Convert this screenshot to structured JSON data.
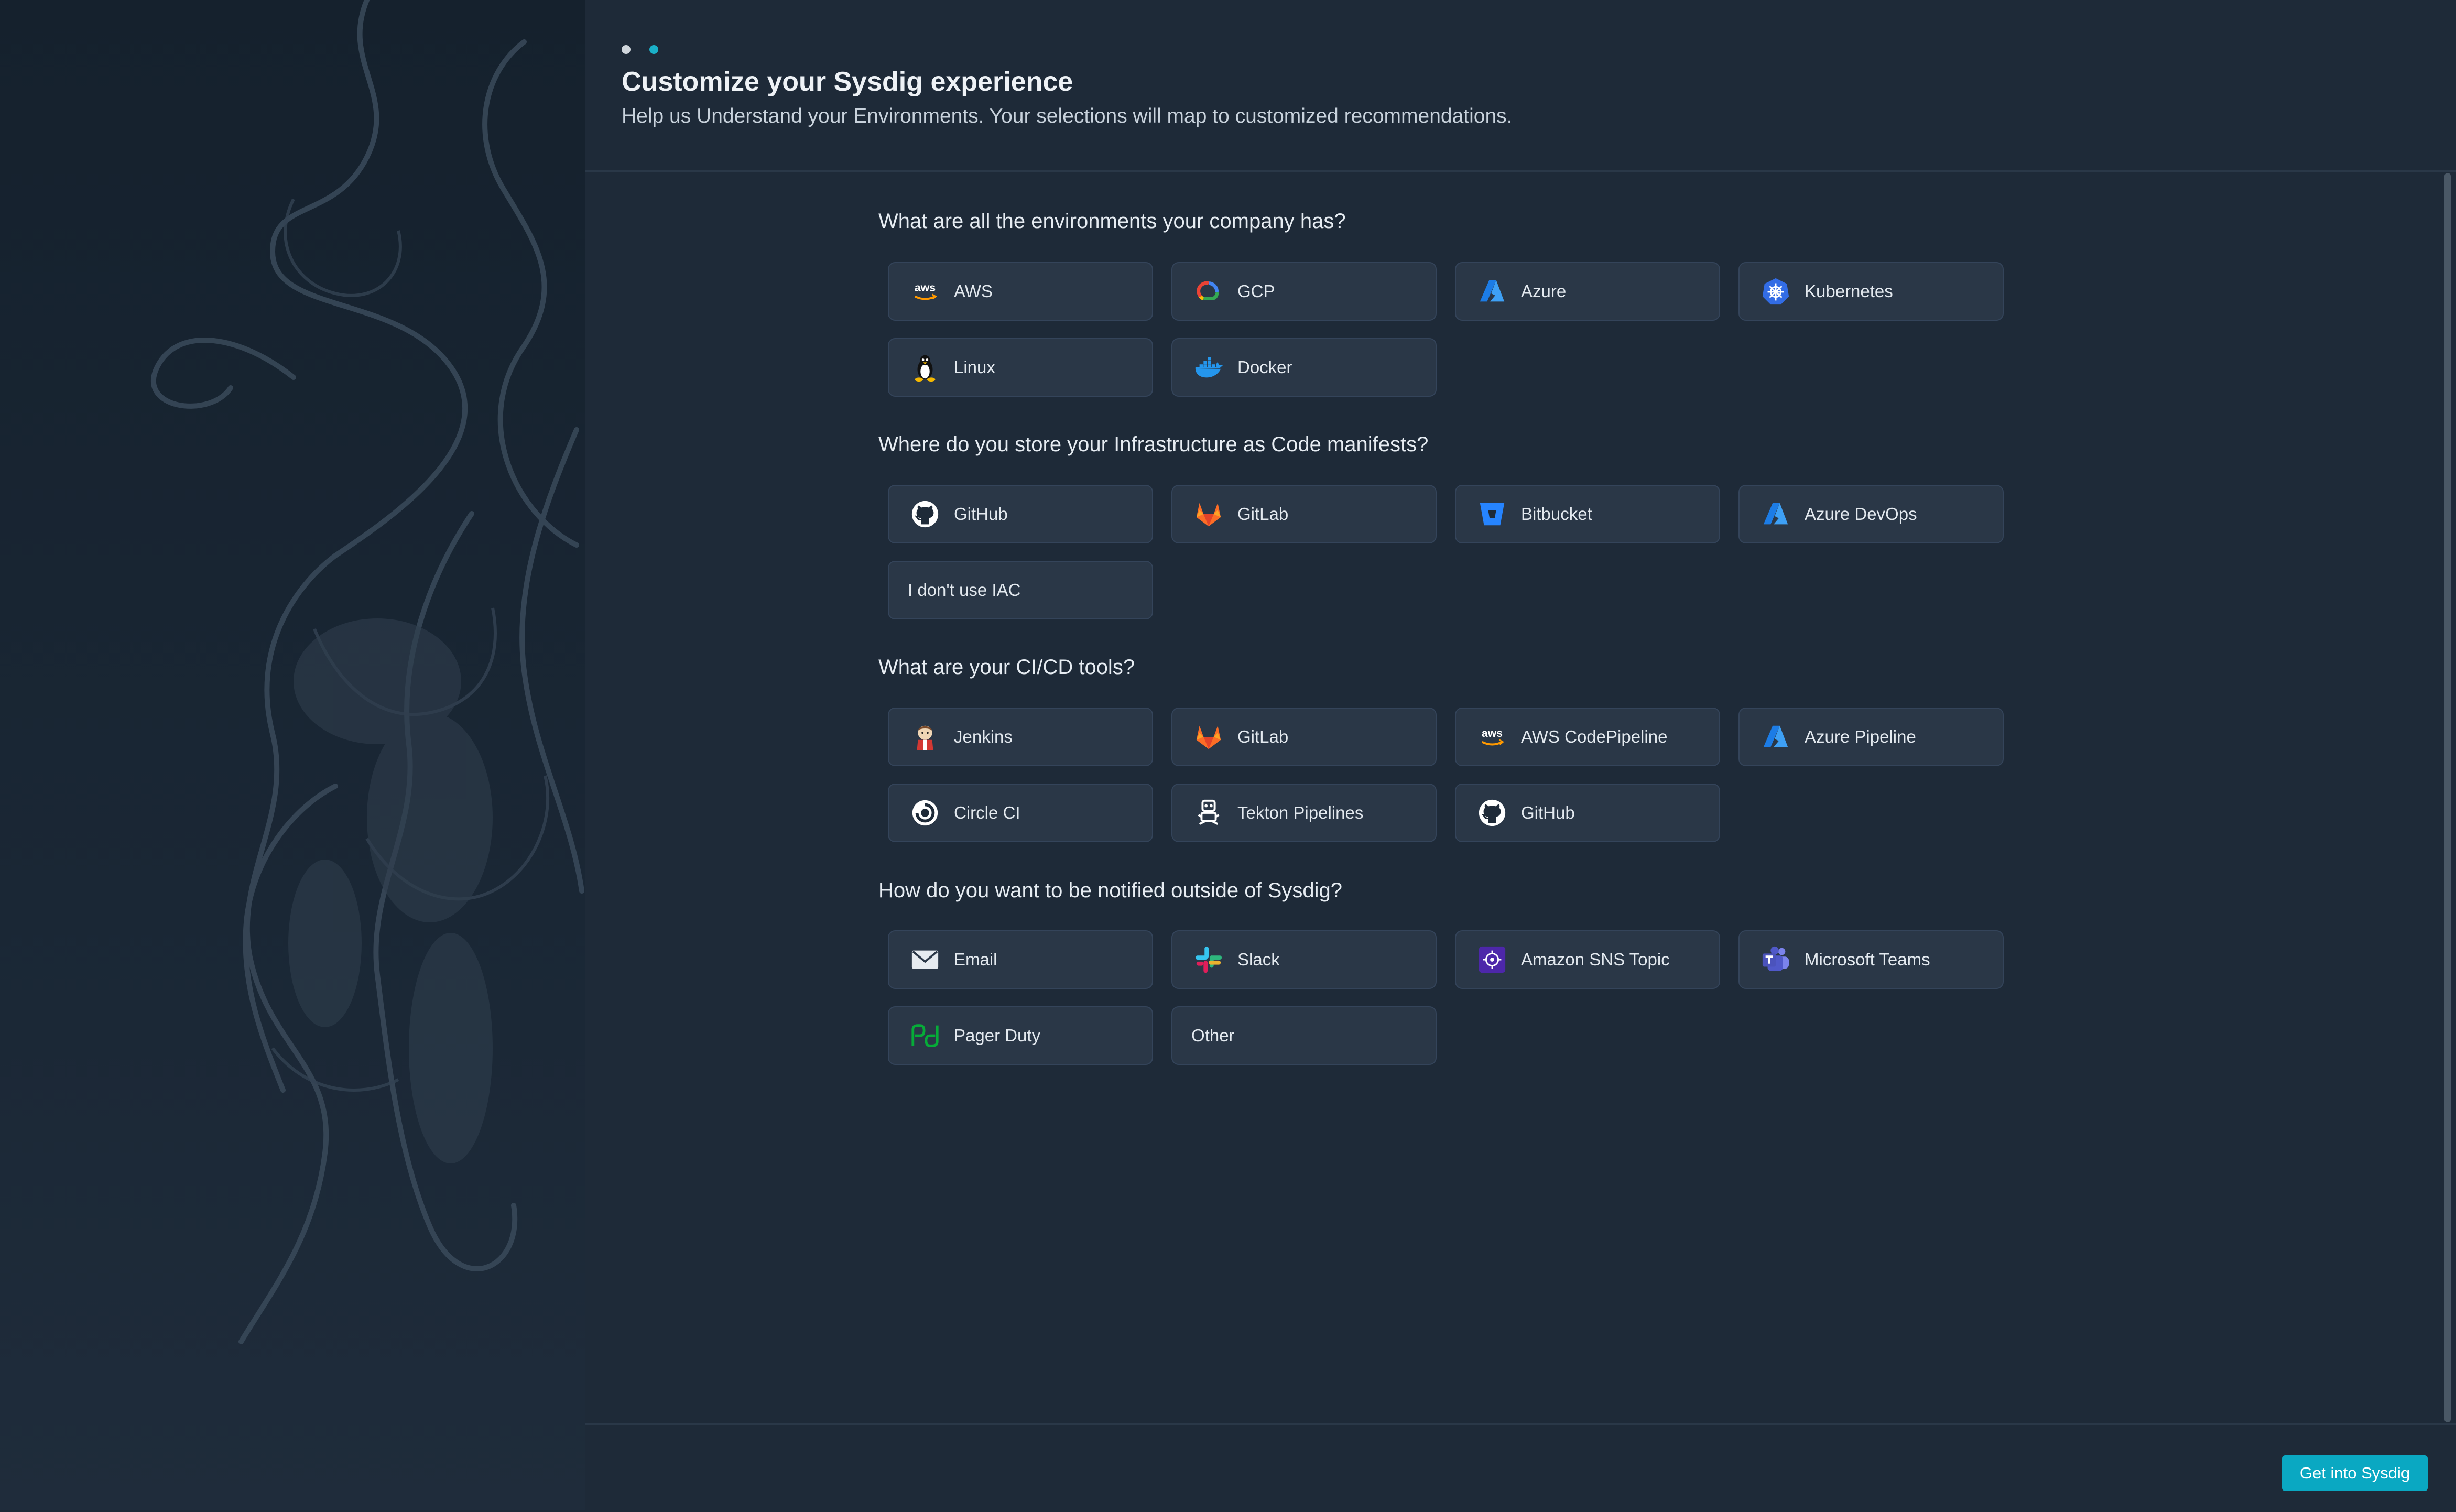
{
  "header": {
    "title": "Customize your Sysdig experience",
    "subtitle": "Help us Understand your Environments. Your selections will map to customized recommendations.",
    "steps": [
      "#d0d6dc",
      "#1ab0c8"
    ]
  },
  "sections": [
    {
      "question": "What are all the environments your company has?",
      "options": [
        {
          "label": "AWS",
          "icon": "aws-icon"
        },
        {
          "label": "GCP",
          "icon": "gcp-icon"
        },
        {
          "label": "Azure",
          "icon": "azure-icon"
        },
        {
          "label": "Kubernetes",
          "icon": "kubernetes-icon"
        },
        {
          "label": "Linux",
          "icon": "linux-icon"
        },
        {
          "label": "Docker",
          "icon": "docker-icon"
        }
      ]
    },
    {
      "question": "Where do you store your Infrastructure as Code manifests?",
      "options": [
        {
          "label": "GitHub",
          "icon": "github-icon"
        },
        {
          "label": "GitLab",
          "icon": "gitlab-icon"
        },
        {
          "label": "Bitbucket",
          "icon": "bitbucket-icon"
        },
        {
          "label": "Azure DevOps",
          "icon": "azure-devops-icon"
        },
        {
          "label": "I don't use IAC",
          "icon": ""
        }
      ]
    },
    {
      "question": "What are your CI/CD tools?",
      "options": [
        {
          "label": "Jenkins",
          "icon": "jenkins-icon"
        },
        {
          "label": "GitLab",
          "icon": "gitlab-icon"
        },
        {
          "label": "AWS CodePipeline",
          "icon": "aws-icon"
        },
        {
          "label": "Azure Pipeline",
          "icon": "azure-icon"
        },
        {
          "label": "Circle CI",
          "icon": "circleci-icon"
        },
        {
          "label": "Tekton Pipelines",
          "icon": "tekton-icon"
        },
        {
          "label": "GitHub",
          "icon": "github-icon"
        }
      ]
    },
    {
      "question": "How do you want to be notified outside of Sysdig?",
      "options": [
        {
          "label": "Email",
          "icon": "email-icon"
        },
        {
          "label": "Slack",
          "icon": "slack-icon"
        },
        {
          "label": "Amazon SNS Topic",
          "icon": "amazon-sns-icon"
        },
        {
          "label": "Microsoft Teams",
          "icon": "microsoft-teams-icon"
        },
        {
          "label": "Pager Duty",
          "icon": "pagerduty-icon"
        },
        {
          "label": "Other",
          "icon": ""
        }
      ]
    }
  ],
  "footer": {
    "cta_label": "Get into Sysdig",
    "cta_color": "#0aa8c2"
  }
}
